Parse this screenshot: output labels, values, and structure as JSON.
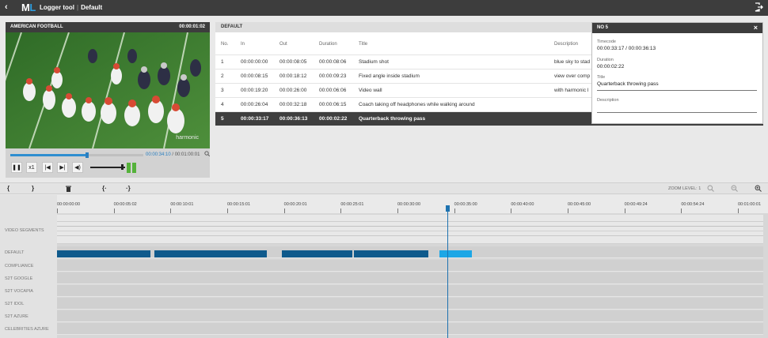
{
  "app": {
    "logo_prefix": "M",
    "logo_suffix": "L",
    "title": "Logger tool",
    "separator": "|",
    "profile": "Default",
    "back_icon": "chevron-left-icon",
    "exit_icon": "logout-icon"
  },
  "player": {
    "title": "AMERICAN FOOTBALL",
    "timecode": "00:00:01:02",
    "watermark": "harmonic",
    "position_fraction": 0.58,
    "current_time": "00:00:34:10",
    "time_separator": "/",
    "total_time": "00:01:00:01",
    "speed_label": "x1",
    "controls": [
      "pause-icon",
      "speed-button",
      "previous-frame-icon",
      "next-frame-icon",
      "volume-icon"
    ],
    "volume_fraction": 0.9
  },
  "table": {
    "title": "DEFAULT",
    "columns": [
      "No.",
      "In",
      "Out",
      "Duration",
      "Title",
      "Description"
    ],
    "rows": [
      {
        "no": "1",
        "in": "00:00:00:00",
        "out": "00:00:08:05",
        "duration": "00:00:08:06",
        "title": "Stadium shot",
        "description": "blue sky to stad"
      },
      {
        "no": "2",
        "in": "00:00:08:15",
        "out": "00:00:18:12",
        "duration": "00:00:09:23",
        "title": "Fixed angle inside stadium",
        "description": "view over comp"
      },
      {
        "no": "3",
        "in": "00:00:19:20",
        "out": "00:00:26:00",
        "duration": "00:00:06:06",
        "title": "Video wall",
        "description": "with harmonic l"
      },
      {
        "no": "4",
        "in": "00:00:26:04",
        "out": "00:00:32:18",
        "duration": "00:00:06:15",
        "title": "Coach taking off headphones while walking around",
        "description": ""
      },
      {
        "no": "5",
        "in": "00:00:33:17",
        "out": "00:00:36:13",
        "duration": "00:00:02:22",
        "title": "Quarterback throwing pass",
        "description": ""
      }
    ],
    "selected_row": 5
  },
  "detail": {
    "title": "NO 5",
    "close": "×",
    "timecode_label": "Timecode",
    "timecode_value": "00:00:33:17 / 00:00:36:13",
    "duration_label": "Duration",
    "duration_value": "00:00:02:22",
    "title_label": "Title",
    "title_value": "Quarterback throwing pass",
    "description_label": "Description",
    "description_value": ""
  },
  "toolbar": {
    "buttons": [
      "{",
      "}",
      "trash-icon",
      "{·",
      "·}"
    ],
    "zoom_label": "ZOOM LEVEL: 1",
    "zoom_icons": [
      "zoom-fit-icon",
      "zoom-out-icon",
      "zoom-in-icon"
    ]
  },
  "timeline": {
    "ticks": [
      "00:00:00:00",
      "00:00:05:02",
      "00:00:10:01",
      "00:00:15:01",
      "00:00:20:01",
      "00:00:25:01",
      "00:00:30:00",
      "00:00:35:00",
      "00:00:40:00",
      "00:00:45:00",
      "00:00:49:24",
      "00:00:54:24",
      "00:01:00:01"
    ],
    "lanes": [
      "VIDEO SEGMENTS",
      "DEFAULT",
      "COMPLIANCE",
      "S2T GOOGLE",
      "S2T VOCAPIA",
      "S2T IDOL",
      "S2T AZURE",
      "CELEBRITIES AZURE"
    ],
    "playhead_seconds": 34.4,
    "total_seconds": 60.0,
    "default_segments": [
      {
        "in": 0.0,
        "out": 8.2,
        "active": false
      },
      {
        "in": 8.6,
        "out": 18.5,
        "active": false
      },
      {
        "in": 19.8,
        "out": 26.0,
        "active": false
      },
      {
        "in": 26.15,
        "out": 32.75,
        "active": false
      },
      {
        "in": 33.7,
        "out": 36.55,
        "active": true
      }
    ]
  },
  "colors": {
    "topbar": "#3d3d3d",
    "accent": "#2f9fe0",
    "segment": "#0f5a8c",
    "segment_active": "#1da7e6",
    "playhead": "#1f73b0"
  }
}
